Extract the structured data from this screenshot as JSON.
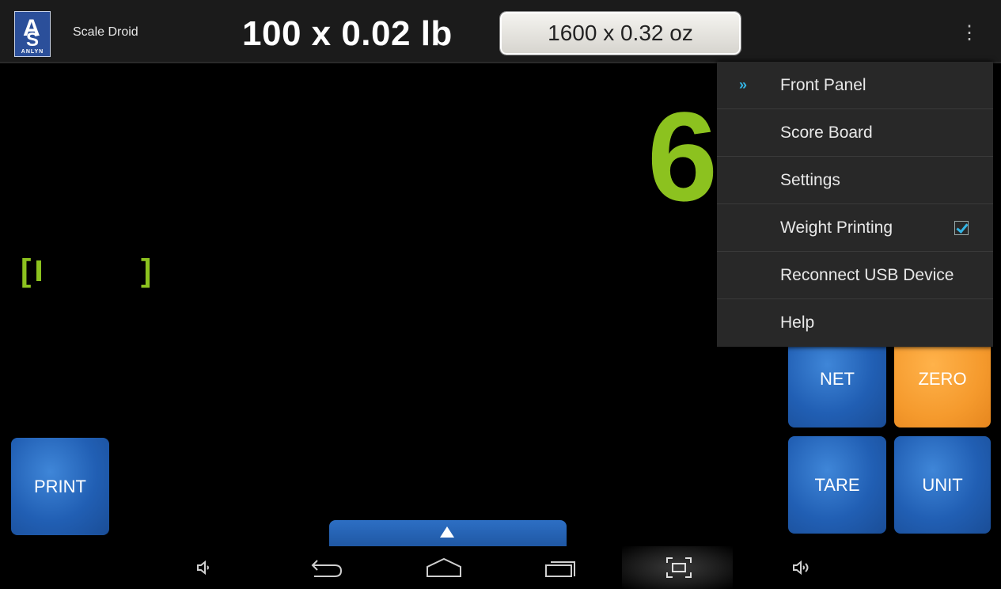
{
  "action_bar": {
    "logo_text": "A",
    "logo_brand": "ANLYN",
    "app_title": "Scale Droid",
    "capacity_primary": "100 x 0.02 lb",
    "capacity_secondary": "1600 x 0.32 oz",
    "overflow_icon": "overflow-menu-icon"
  },
  "display": {
    "weight_reading": "6",
    "bargraph_left": "[",
    "bargraph_right": "]",
    "bargraph_fill_fraction": 0.05,
    "accent_color": "#8cc21f"
  },
  "buttons": {
    "print": "PRINT",
    "net": "NET",
    "zero": "ZERO",
    "tare": "TARE",
    "unit": "UNIT"
  },
  "menu": {
    "items": [
      {
        "label": "Front Panel",
        "marker": "»",
        "selected": true
      },
      {
        "label": "Score Board"
      },
      {
        "label": "Settings"
      },
      {
        "label": "Weight Printing",
        "checked": true
      },
      {
        "label": "Reconnect USB Device"
      },
      {
        "label": "Help"
      }
    ]
  },
  "nav_bar": {
    "icons": [
      "volume-down-icon",
      "back-icon",
      "home-icon",
      "recent-apps-icon",
      "screenshot-icon",
      "volume-up-icon"
    ]
  },
  "colors": {
    "button_blue": "#215fb4",
    "button_orange": "#f59a2d",
    "menu_highlight": "#33b5e5"
  }
}
